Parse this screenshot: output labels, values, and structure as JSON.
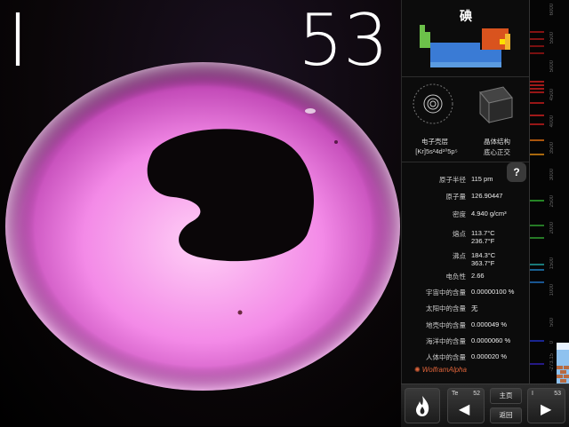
{
  "element": {
    "symbol": "I",
    "atomic_number": "53",
    "name": "碘"
  },
  "structure": {
    "shell_caption": "电子壳层",
    "shell_config": "[Kr]5s²4d¹⁰5p⁵",
    "crystal_caption": "晶体结构",
    "crystal_type": "底心正交"
  },
  "help_label": "?",
  "properties": [
    {
      "label": "原子半径",
      "value": "115 pm"
    },
    {
      "label": "原子量",
      "value": "126.90447"
    },
    {
      "label": "密度",
      "value": "4.940 g/cm³"
    },
    {
      "label": "熔点",
      "value": "113.7°C",
      "value2": "236.7°F"
    },
    {
      "label": "沸点",
      "value": "184.3°C",
      "value2": "363.7°F"
    },
    {
      "label": "电负性",
      "value": "2.66"
    },
    {
      "label": "宇宙中的含量",
      "value": "0.00000100 %"
    },
    {
      "label": "太阳中的含量",
      "value": "无"
    },
    {
      "label": "地壳中的含量",
      "value": "0.000049 %"
    },
    {
      "label": "海洋中的含量",
      "value": "0.0000060 %"
    },
    {
      "label": "人体中的含量",
      "value": "0.000020 %"
    }
  ],
  "brand": "WolframAlpha",
  "spectrum_scale": [
    "6000",
    "5500",
    "5000",
    "4500",
    "4000",
    "3500",
    "3000",
    "2500",
    "2000",
    "1500",
    "1000",
    "500",
    "0",
    "-273.15"
  ],
  "toolbar": {
    "prev_symbol": "Te",
    "prev_number": "52",
    "next_symbol": "I",
    "next_number": "53",
    "home_label": "主页",
    "back_label": "返回"
  },
  "colors": {
    "sample_pink": "#f27ee6",
    "sample_core": "#0a0608",
    "halogen_block": "#d9531e",
    "alkali_block": "#6cc04a",
    "transition_block": "#3a7bd5"
  },
  "icons": {
    "flame": "flame-icon",
    "prev": "left-arrow-icon",
    "next": "right-arrow-icon"
  }
}
